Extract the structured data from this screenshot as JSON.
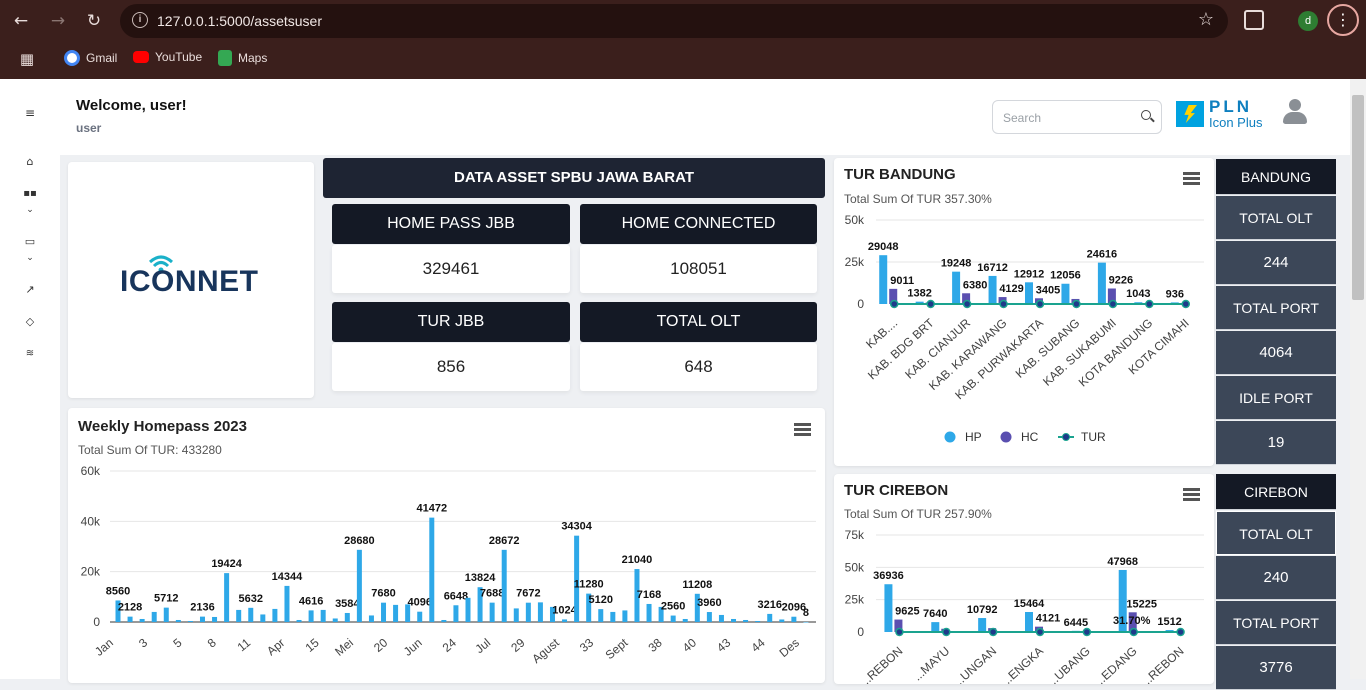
{
  "browser": {
    "url": "127.0.0.1:5000/assetsuser",
    "profile_initial": "d",
    "bookmarks": [
      "Gmail",
      "YouTube",
      "Maps"
    ]
  },
  "header": {
    "welcome": "Welcome, user!",
    "username": "user",
    "search_placeholder": "Search",
    "brand_top": "PLN",
    "brand_bottom": "Icon Plus"
  },
  "logo_card": {
    "brand": "ICONNET"
  },
  "asset": {
    "title": "DATA ASSET SPBU JAWA BARAT",
    "kpis": [
      {
        "label": "HOME PASS JBB",
        "value": "329461"
      },
      {
        "label": "HOME CONNECTED",
        "value": "108051"
      },
      {
        "label": "TUR JBB",
        "value": "856"
      },
      {
        "label": "TOTAL OLT",
        "value": "648"
      }
    ]
  },
  "bandung_panel": {
    "title": "BANDUNG",
    "rows": [
      {
        "label": "TOTAL OLT",
        "value": "244"
      },
      {
        "label": "TOTAL PORT",
        "value": "4064"
      },
      {
        "label": "IDLE PORT",
        "value": "19"
      }
    ]
  },
  "cirebon_panel": {
    "title": "CIREBON",
    "rows": [
      {
        "label": "TOTAL OLT",
        "value": "240"
      },
      {
        "label": "TOTAL PORT",
        "value": "3776"
      }
    ]
  },
  "colors": {
    "hp": "#2ea8e8",
    "hc": "#5a4fb0",
    "tur": "#1aa38f",
    "dark": "#141925",
    "panel": "#3c4758"
  },
  "chart_data": [
    {
      "type": "bar",
      "title": "Weekly Homepass 2023",
      "subtitle": "Total Sum Of TUR: 433280",
      "ylim": [
        0,
        60000
      ],
      "yticks": [
        "0",
        "20k",
        "40k",
        "60k"
      ],
      "tick_labels": [
        "Jan",
        "3",
        "5",
        "8",
        "11",
        "Apr",
        "15",
        "Mei",
        "20",
        "Jun",
        "24",
        "Jul",
        "29",
        "Agust",
        "33",
        "Sept",
        "38",
        "40",
        "43",
        "44",
        "Des"
      ],
      "values": [
        8560,
        2128,
        1200,
        4000,
        5712,
        800,
        400,
        2136,
        2000,
        19424,
        4800,
        5632,
        3000,
        5200,
        14344,
        800,
        4616,
        4800,
        1400,
        3584,
        28680,
        2600,
        7680,
        6800,
        7000,
        4096,
        41472,
        800,
        6648,
        9600,
        13824,
        7688,
        28672,
        5400,
        7672,
        7800,
        6000,
        1024,
        34304,
        11280,
        5120,
        4000,
        4600,
        21040,
        7168,
        6000,
        2560,
        1200,
        11208,
        3960,
        2800,
        1200,
        800,
        400,
        3216,
        1000,
        2096,
        8
      ],
      "data_labels": [
        "8560",
        "2128",
        "",
        "",
        "5712",
        "",
        "",
        "2136",
        "",
        "19424",
        "",
        "5632",
        "",
        "",
        "14344",
        "",
        "4616",
        "",
        "",
        "3584",
        "28680",
        "",
        "7680",
        "",
        "",
        "4096",
        "41472",
        "",
        "6648",
        "",
        "13824",
        "7688",
        "28672",
        "",
        "7672",
        "",
        "",
        "1024",
        "34304",
        "11280",
        "5120",
        "",
        "",
        "21040",
        "7168",
        "",
        "2560",
        "",
        "11208",
        "3960",
        "",
        "",
        "",
        "",
        "3216",
        "",
        "2096",
        "8"
      ]
    },
    {
      "type": "bar",
      "title": "TUR BANDUNG",
      "subtitle": "Total Sum Of TUR 357.30%",
      "ylim": [
        0,
        50000
      ],
      "yticks": [
        "0",
        "25k",
        "50k"
      ],
      "categories": [
        "KAB....",
        "KAB. BDG BRT",
        "KAB. CIANJUR",
        "KAB. KARAWANG",
        "KAB. PURWAKARTA",
        "KAB. SUBANG",
        "KAB. SUKABUMI",
        "KOTA BANDUNG",
        "KOTA CIMAHI"
      ],
      "series": [
        {
          "name": "HP",
          "values": [
            29048,
            1382,
            19248,
            16712,
            12912,
            12056,
            24616,
            1043,
            936
          ]
        },
        {
          "name": "HC",
          "values": [
            9011,
            900,
            6380,
            4129,
            3405,
            3000,
            9226,
            500,
            400
          ]
        },
        {
          "name": "TUR",
          "values": [
            0.5,
            0.5,
            0.5,
            0.5,
            0.5,
            0.5,
            0.5,
            0.5,
            0.5
          ]
        }
      ],
      "data_labels": {
        "HP": [
          "29048",
          "1382",
          "19248",
          "16712",
          "12912",
          "12056",
          "24616",
          "1043",
          "936"
        ],
        "HC": [
          "9011",
          "",
          "6380",
          "4129",
          "3405",
          "",
          "9226",
          "",
          ""
        ]
      },
      "legend": [
        "HP",
        "HC",
        "TUR"
      ]
    },
    {
      "type": "bar",
      "title": "TUR CIREBON",
      "subtitle": "Total Sum Of TUR 257.90%",
      "ylim": [
        0,
        75000
      ],
      "yticks": [
        "0",
        "25k",
        "50k",
        "75k"
      ],
      "categories": [
        "...REBON",
        "...MAYU",
        "...UNGAN",
        "...ENGKA",
        "...UBANG",
        "...EDANG",
        "...REBON"
      ],
      "series": [
        {
          "name": "HP",
          "values": [
            36936,
            7640,
            10792,
            15464,
            900,
            47968,
            1512
          ]
        },
        {
          "name": "HC",
          "values": [
            9625,
            2500,
            3000,
            4121,
            400,
            15225,
            500
          ]
        },
        {
          "name": "TUR",
          "values": [
            0.5,
            0.5,
            0.5,
            0.5,
            0.5,
            0.5,
            0.5
          ]
        }
      ],
      "data_labels": {
        "HP": [
          "36936",
          "7640",
          "10792",
          "15464",
          "6445",
          "47968",
          "1512"
        ],
        "HC": [
          "9625",
          "",
          "",
          "4121",
          "",
          "15225",
          ""
        ],
        "TUR": [
          "",
          "",
          "",
          "",
          "",
          "31.70%",
          ""
        ]
      }
    }
  ]
}
